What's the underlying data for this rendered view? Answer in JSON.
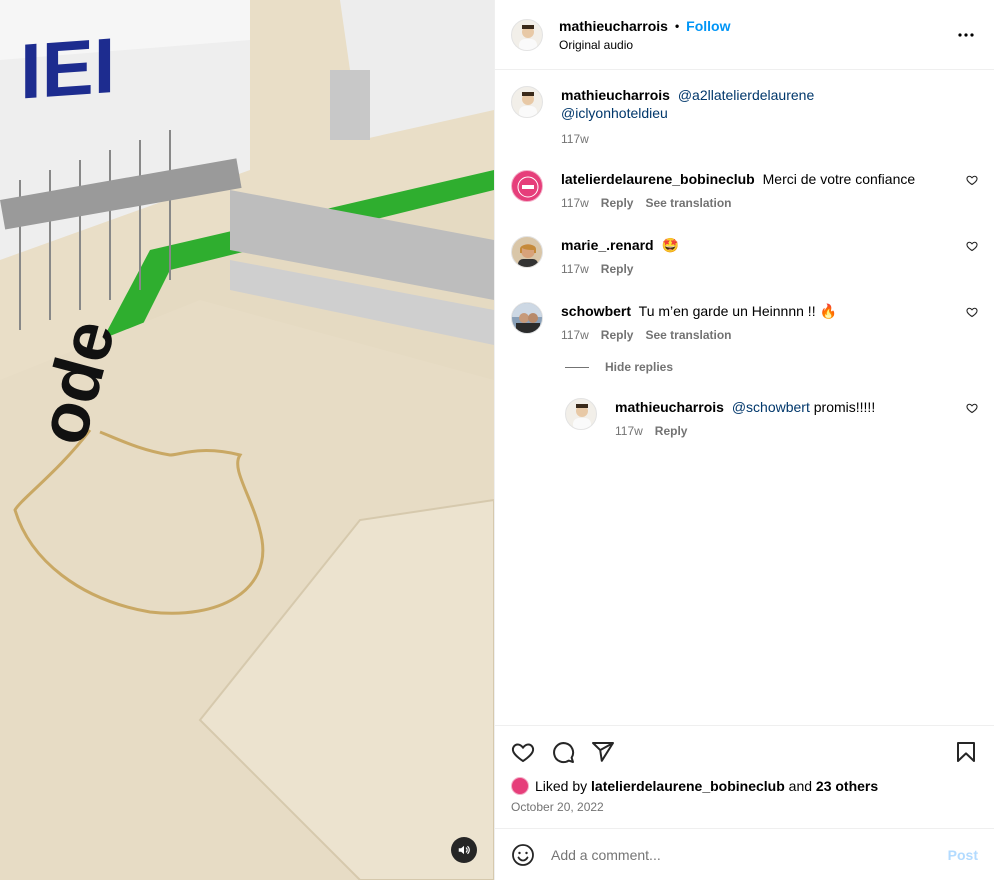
{
  "header": {
    "username": "mathieucharrois",
    "dot": "•",
    "follow_label": "Follow",
    "audio_label": "Original audio",
    "more_icon": "more-horizontal-icon"
  },
  "media": {
    "audio_icon": "speaker-icon",
    "visible_text": "ode"
  },
  "caption": {
    "username": "mathieucharrois",
    "mention1": "@a2llatelierdelaurene",
    "mention2": "@iclyonhoteldieu",
    "time": "117w"
  },
  "comments": [
    {
      "username": "latelierdelaurene_bobineclub",
      "text": "Merci de votre confiance",
      "time": "117w",
      "reply": "Reply",
      "translate": "See translation"
    },
    {
      "username": "marie_.renard",
      "text": "🤩",
      "time": "117w",
      "reply": "Reply"
    },
    {
      "username": "schowbert",
      "text": "Tu m’en garde un Heinnnn !! 🔥",
      "time": "117w",
      "reply": "Reply",
      "translate": "See translation"
    }
  ],
  "hide_replies": "Hide replies",
  "reply": {
    "username": "mathieucharrois",
    "mention": "@schowbert",
    "text": "promis!!!!!",
    "time": "117w",
    "reply": "Reply"
  },
  "likes": {
    "prefix": "Liked by",
    "user": "latelierdelaurene_bobineclub",
    "and": "and",
    "others": "23 others"
  },
  "date": "October 20, 2022",
  "add_comment": {
    "placeholder": "Add a comment...",
    "post_label": "Post"
  },
  "colors": {
    "link_blue": "#0095f6",
    "mention_blue": "#00376b",
    "muted": "#737373",
    "post_disabled": "#b3dbff"
  }
}
